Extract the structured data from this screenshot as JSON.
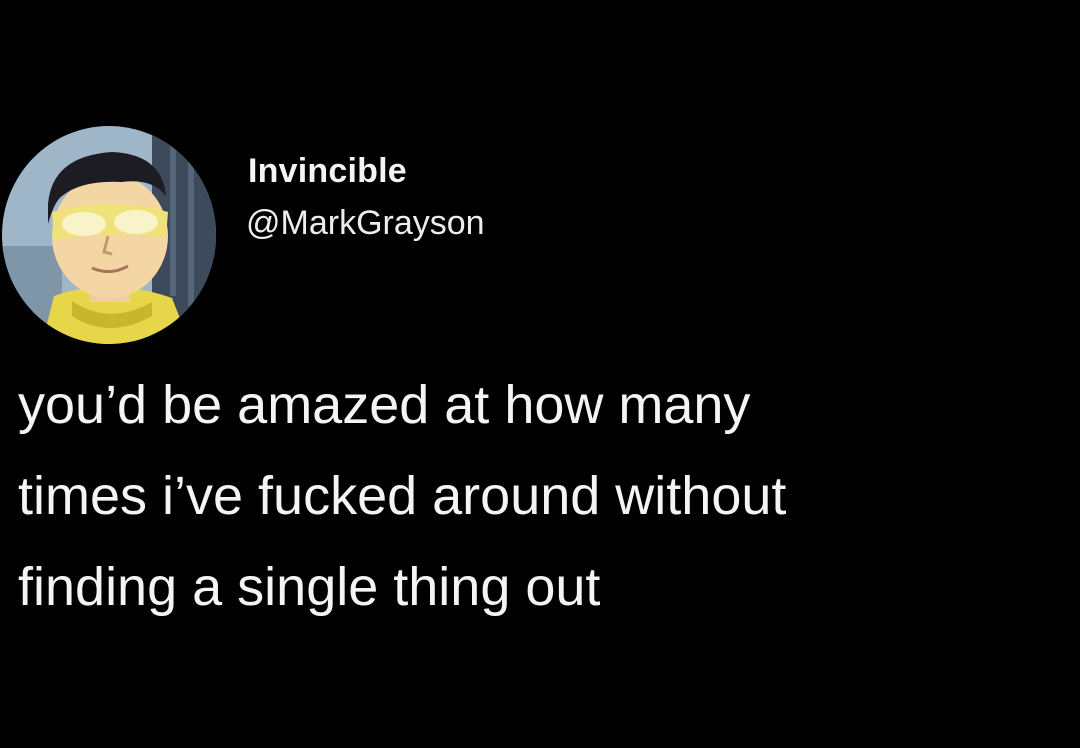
{
  "tweet": {
    "author": {
      "display_name": "Invincible",
      "handle": "@MarkGrayson",
      "avatar_icon": "avatar-cartoon-hero-icon"
    },
    "text": "you’d be amazed at how many\ntimes  i’ve fucked around without\nfinding a single thing out"
  },
  "colors": {
    "background": "#000000",
    "text": "#f4f4f4"
  }
}
